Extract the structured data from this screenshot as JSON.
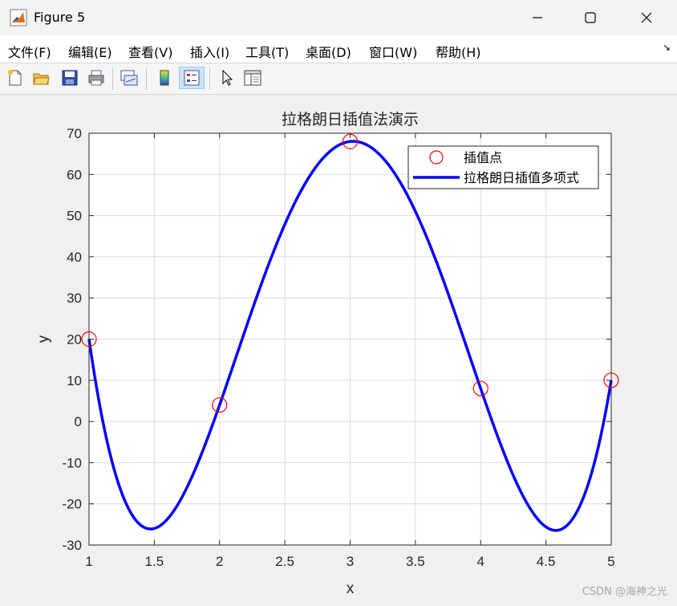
{
  "window": {
    "title": "Figure 5"
  },
  "menu": [
    "文件(F)",
    "编辑(E)",
    "查看(V)",
    "插入(I)",
    "工具(T)",
    "桌面(D)",
    "窗口(W)",
    "帮助(H)"
  ],
  "toolbar_icons": [
    "new-figure-icon",
    "open-file-icon",
    "save-icon",
    "print-icon",
    "link-plot-icon",
    "colorbar-icon",
    "legend-icon",
    "pointer-icon",
    "property-inspector-icon"
  ],
  "chart_data": {
    "type": "line",
    "title": "拉格朗日插值法演示",
    "xlabel": "x",
    "ylabel": "y",
    "xlim": [
      1,
      5
    ],
    "ylim": [
      -30,
      70
    ],
    "xticks": [
      1,
      1.5,
      2,
      2.5,
      3,
      3.5,
      4,
      4.5,
      5
    ],
    "xtick_labels": [
      "1",
      "1.5",
      "2",
      "2.5",
      "3",
      "3.5",
      "4",
      "4.5",
      "5"
    ],
    "yticks": [
      -30,
      -20,
      -10,
      0,
      10,
      20,
      30,
      40,
      50,
      60,
      70
    ],
    "ytick_labels": [
      "-30",
      "-20",
      "-10",
      "0",
      "10",
      "20",
      "30",
      "40",
      "50",
      "60",
      "70"
    ],
    "grid": true,
    "legend_position": "top-right",
    "series": [
      {
        "name": "插值点",
        "kind": "scatter",
        "marker": "circle",
        "color": "#ff0000",
        "x": [
          1,
          2,
          3,
          4,
          5
        ],
        "y": [
          20,
          4,
          68,
          8,
          10
        ]
      },
      {
        "name": "拉格朗日插值多项式",
        "kind": "line",
        "color": "#0000ff",
        "x": [
          1,
          1.25,
          1.5,
          1.75,
          2,
          2.25,
          2.5,
          2.75,
          3,
          3.25,
          3.5,
          3.75,
          4,
          4.25,
          4.5,
          4.75,
          5
        ],
        "y": [
          20,
          -13.2,
          -26.1,
          -16.3,
          4,
          30.1,
          51.9,
          65.4,
          68,
          59.1,
          40.6,
          16.9,
          8,
          -19.4,
          -26.3,
          -15.5,
          10
        ]
      }
    ]
  },
  "watermark": "CSDN @海神之光"
}
